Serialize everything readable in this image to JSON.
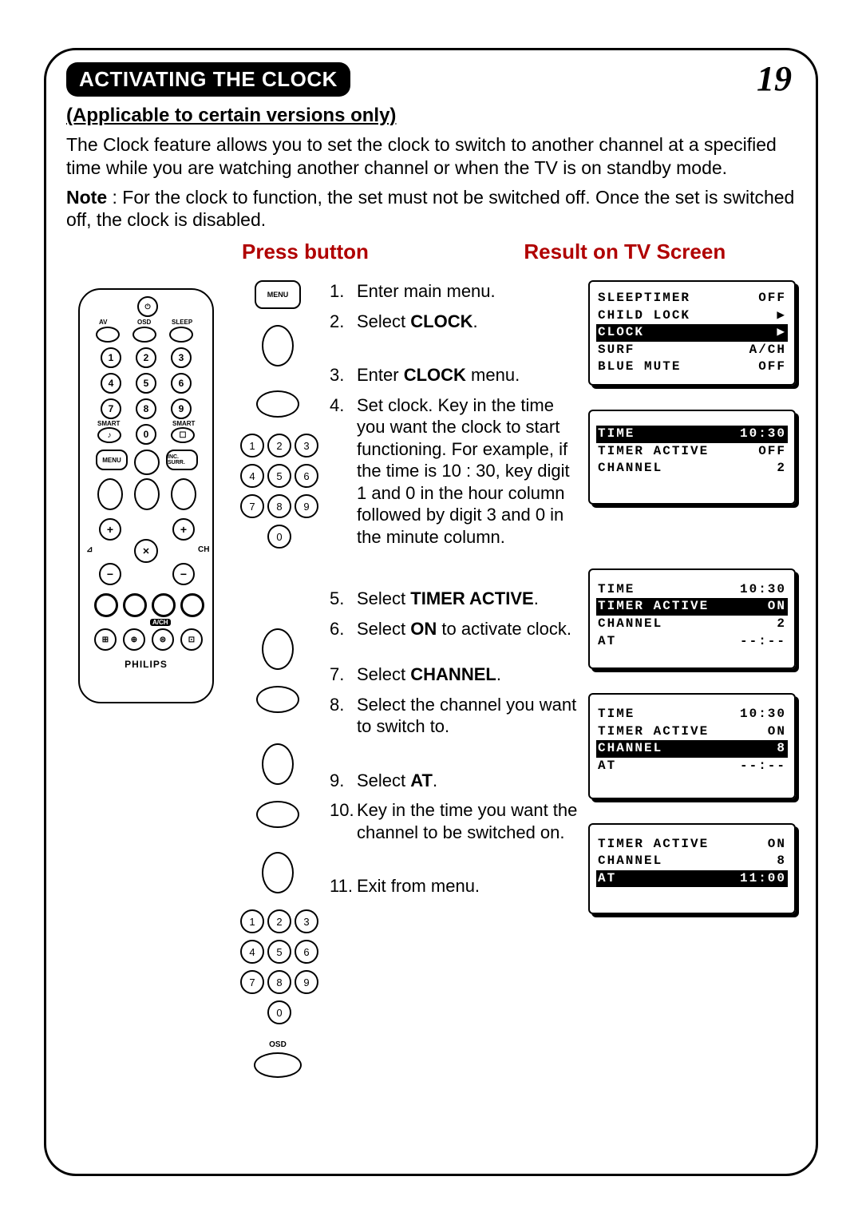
{
  "page_number": "19",
  "title": "ACTIVATING THE CLOCK",
  "subtitle": "(Applicable to certain versions only)",
  "intro_p1": "The Clock feature allows you to set the clock to switch to another channel at a specified time while you are watching another channel or when the TV is on standby mode.",
  "intro_note_label": "Note",
  "intro_note_text": " : For the clock to function, the set must not be switched off. Once the set is switched off, the clock is disabled.",
  "col_press": "Press button",
  "col_result": "Result on TV Screen",
  "remote": {
    "brand": "PHILIPS",
    "menu": "MENU",
    "osd": "OSD",
    "av": "AV",
    "sleep": "SLEEP",
    "smart_l": "SMART",
    "smart_r": "SMART",
    "inc_surr": "INC. SURR.",
    "ch": "CH",
    "vol": "⊿",
    "ach": "A/CH",
    "mute": "◀✕"
  },
  "press": {
    "menu": "MENU",
    "osd": "OSD"
  },
  "steps": [
    {
      "n": "1.",
      "t": "Enter main menu."
    },
    {
      "n": "2.",
      "pre": "Select ",
      "b": "CLOCK",
      "post": "."
    },
    {
      "n": "3.",
      "pre": "Enter ",
      "b": "CLOCK",
      "post": " menu."
    },
    {
      "n": "4.",
      "t": "Set clock. Key in the time you want the clock to start functioning. For example, if the time is 10 : 30, key digit 1 and 0 in the hour column followed by digit 3 and 0 in the minute column."
    },
    {
      "n": "5.",
      "pre": "Select ",
      "b": "TIMER ACTIVE",
      "post": "."
    },
    {
      "n": "6.",
      "pre": "Select ",
      "b": "ON",
      "post": " to activate clock."
    },
    {
      "n": "7.",
      "pre": "Select ",
      "b": "CHANNEL",
      "post": "."
    },
    {
      "n": "8.",
      "t": "Select the channel you want to switch to."
    },
    {
      "n": "9.",
      "pre": "Select ",
      "b": "AT",
      "post": "."
    },
    {
      "n": "10.",
      "t": "Key in the time you want the channel to be switched on."
    },
    {
      "n": "11.",
      "t": "Exit from menu."
    }
  ],
  "screens": {
    "s1": [
      {
        "l": "SLEEPTIMER",
        "r": "OFF",
        "hl": false
      },
      {
        "l": "CHILD LOCK",
        "r": "▶",
        "hl": false
      },
      {
        "l": "CLOCK",
        "r": "▶",
        "hl": true
      },
      {
        "l": "SURF",
        "r": "A/CH",
        "hl": false
      },
      {
        "l": "BLUE MUTE",
        "r": "OFF",
        "hl": false
      }
    ],
    "s2": [
      {
        "l": "TIME",
        "r": "10:30",
        "hl": true
      },
      {
        "l": "TIMER ACTIVE",
        "r": "OFF",
        "hl": false
      },
      {
        "l": "CHANNEL",
        "r": "2",
        "hl": false
      }
    ],
    "s3": [
      {
        "l": "TIME",
        "r": "10:30",
        "hl": false
      },
      {
        "l": "TIMER ACTIVE",
        "r": "ON",
        "hl": true
      },
      {
        "l": "CHANNEL",
        "r": "2",
        "hl": false
      },
      {
        "l": "AT",
        "r": "--:--",
        "hl": false
      }
    ],
    "s4": [
      {
        "l": "TIME",
        "r": "10:30",
        "hl": false
      },
      {
        "l": "TIMER ACTIVE",
        "r": "ON",
        "hl": false
      },
      {
        "l": "CHANNEL",
        "r": "8",
        "hl": true
      },
      {
        "l": "AT",
        "r": "--:--",
        "hl": false
      }
    ],
    "s5": [
      {
        "l": "TIMER ACTIVE",
        "r": "ON",
        "hl": false
      },
      {
        "l": "CHANNEL",
        "r": "8",
        "hl": false
      },
      {
        "l": "AT",
        "r": "11:00",
        "hl": true
      }
    ]
  }
}
